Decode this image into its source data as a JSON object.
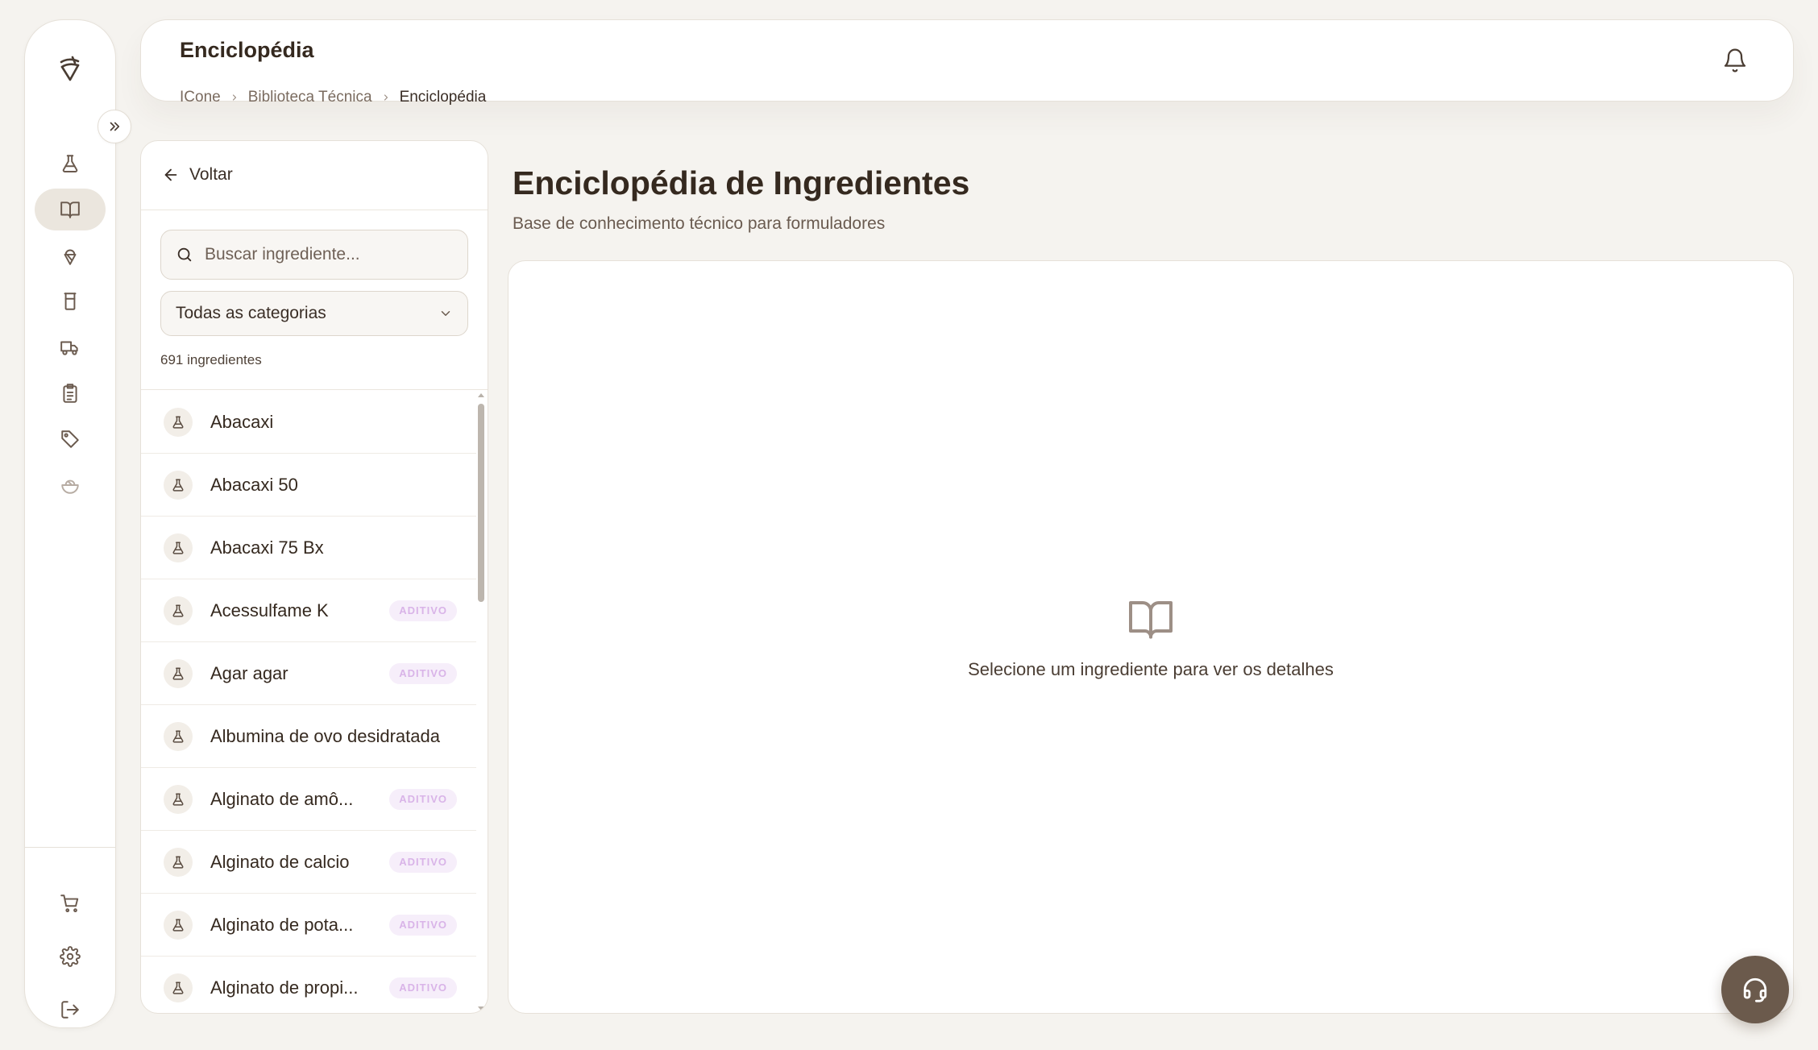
{
  "header": {
    "title": "Enciclopédia",
    "breadcrumb": [
      "ICone",
      "Biblioteca Técnica",
      "Enciclopédia"
    ]
  },
  "sidebar": {
    "icons": [
      "logo-icon",
      "flask-icon",
      "book-icon",
      "ice-cream-icon",
      "glass-icon",
      "truck-icon",
      "clipboard-icon",
      "tag-icon",
      "bowl-icon"
    ],
    "bottom_icons": [
      "cart-icon",
      "gear-icon",
      "logout-icon"
    ]
  },
  "list_panel": {
    "back_label": "Voltar",
    "search_placeholder": "Buscar ingrediente...",
    "category_select": "Todas as categorias",
    "count_label": "691 ingredientes",
    "items": [
      {
        "name": "Abacaxi",
        "badge": ""
      },
      {
        "name": "Abacaxi 50",
        "badge": ""
      },
      {
        "name": "Abacaxi 75 Bx",
        "badge": ""
      },
      {
        "name": "Acessulfame K",
        "badge": "ADITIVO"
      },
      {
        "name": "Agar agar",
        "badge": "ADITIVO"
      },
      {
        "name": "Albumina de ovo desidratada",
        "badge": ""
      },
      {
        "name": "Alginato de amô...",
        "badge": "ADITIVO"
      },
      {
        "name": "Alginato de calcio",
        "badge": "ADITIVO"
      },
      {
        "name": "Alginato de pota...",
        "badge": "ADITIVO"
      },
      {
        "name": "Alginato de propi...",
        "badge": "ADITIVO"
      }
    ]
  },
  "main": {
    "title": "Enciclopédia de Ingredientes",
    "subtitle": "Base de conhecimento técnico para formuladores",
    "empty_state": "Selecione um ingrediente para ver os detalhes"
  },
  "colors": {
    "background": "#f5f3ef",
    "accent_brown": "#6b5a4c",
    "badge_text": "#d9b4e8",
    "badge_bg": "#f6eefa"
  }
}
